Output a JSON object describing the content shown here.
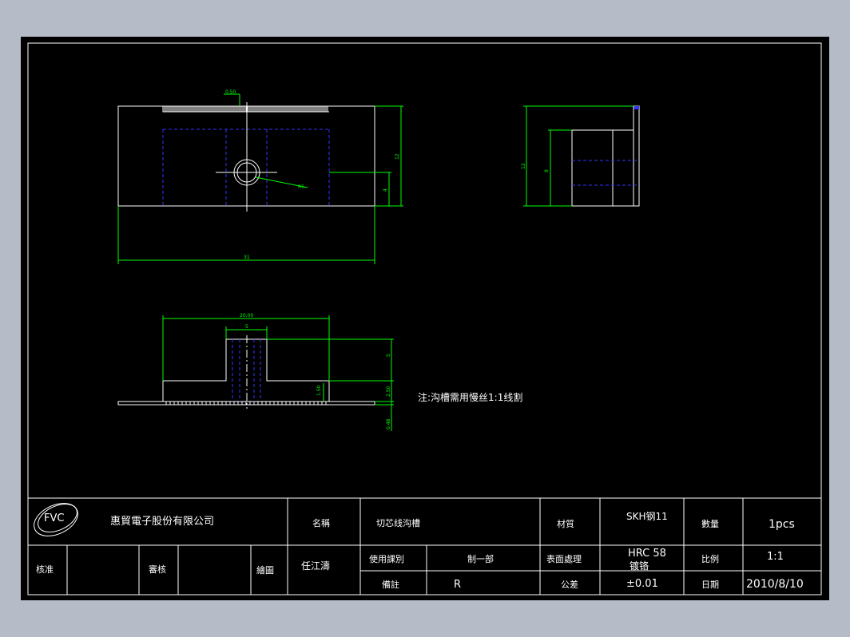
{
  "colors": {
    "background": "#b6bcc7",
    "paper": "#000000",
    "outline": "#ffffff",
    "dimension": "#00ff00",
    "hidden_line": "#3333ff"
  },
  "dimensions": {
    "top_view_width": "31",
    "top_view_height": "12",
    "top_view_offset": "4",
    "top_view_pitch": "0.50",
    "top_view_hole": "R5",
    "side_view_height": "12",
    "side_view_inner": "9",
    "front_view_width": "20.00",
    "front_view_slot": "5",
    "front_view_step": "5",
    "front_view_thick": "2.50",
    "front_view_small": "1.50",
    "front_view_base": "0.48"
  },
  "note": "注:沟槽需用慢丝1:1线割",
  "title_block": {
    "logo_text": "FVC",
    "company": "惠貿電子股份有限公司",
    "name_label": "名稱",
    "name_value": "切芯线沟槽",
    "material_label": "材質",
    "material_value": "SKH钢11",
    "quantity_label": "數量",
    "quantity_value": "1pcs",
    "approve_label": "核准",
    "review_label": "審核",
    "drawer_label": "繪圖",
    "drawer_value": "任江濤",
    "dept_label": "使用課別",
    "dept_value": "制一部",
    "surface_label": "表面處理",
    "surface_value_1": "HRC 58",
    "surface_value_2": "镀铬",
    "scale_label": "比例",
    "scale_value": "1:1",
    "remark_label": "備註",
    "remark_value": "R",
    "tolerance_label": "公差",
    "tolerance_value": "±0.01",
    "date_label": "日期",
    "date_value": "2010/8/10"
  }
}
